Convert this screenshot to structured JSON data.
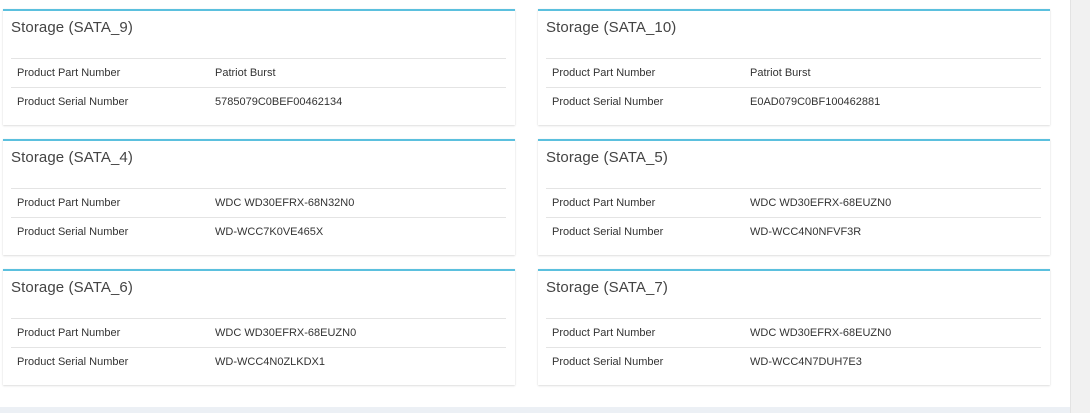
{
  "storage_boxes": [
    {
      "title": "Storage (SATA_9)",
      "rows": [
        {
          "label": "Product Part Number",
          "value": "Patriot Burst"
        },
        {
          "label": "Product Serial Number",
          "value": "5785079C0BEF00462134"
        }
      ]
    },
    {
      "title": "Storage (SATA_10)",
      "rows": [
        {
          "label": "Product Part Number",
          "value": "Patriot Burst"
        },
        {
          "label": "Product Serial Number",
          "value": "E0AD079C0BF100462881"
        }
      ]
    },
    {
      "title": "Storage (SATA_4)",
      "rows": [
        {
          "label": "Product Part Number",
          "value": "WDC WD30EFRX-68N32N0"
        },
        {
          "label": "Product Serial Number",
          "value": "WD-WCC7K0VE465X"
        }
      ]
    },
    {
      "title": "Storage (SATA_5)",
      "rows": [
        {
          "label": "Product Part Number",
          "value": "WDC WD30EFRX-68EUZN0"
        },
        {
          "label": "Product Serial Number",
          "value": "WD-WCC4N0NFVF3R"
        }
      ]
    },
    {
      "title": "Storage (SATA_6)",
      "rows": [
        {
          "label": "Product Part Number",
          "value": "WDC WD30EFRX-68EUZN0"
        },
        {
          "label": "Product Serial Number",
          "value": "WD-WCC4N0ZLKDX1"
        }
      ]
    },
    {
      "title": "Storage (SATA_7)",
      "rows": [
        {
          "label": "Product Part Number",
          "value": "WDC WD30EFRX-68EUZN0"
        },
        {
          "label": "Product Serial Number",
          "value": "WD-WCC4N7DUH7E3"
        }
      ]
    }
  ],
  "colors": {
    "box_accent": "#5bc0de",
    "page_background": "#ecf0f5",
    "text": "#333333"
  }
}
